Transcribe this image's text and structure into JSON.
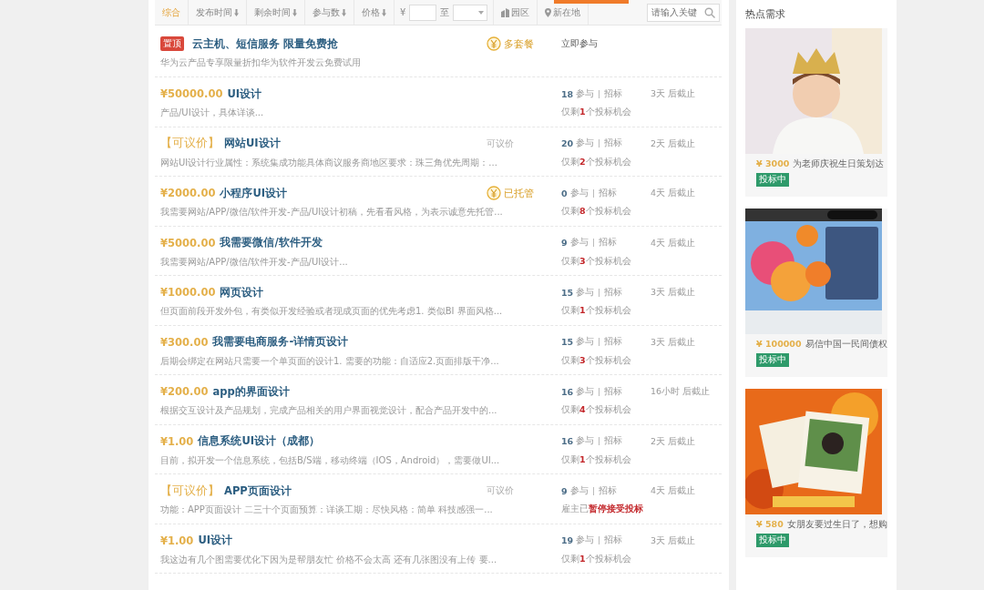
{
  "filters": {
    "sorts": [
      {
        "label": "综合",
        "arrow": false,
        "selected": true
      },
      {
        "label": "发布时间",
        "arrow": true,
        "selected": false
      },
      {
        "label": "剩余时间",
        "arrow": true,
        "selected": false
      },
      {
        "label": "参与数",
        "arrow": true,
        "selected": false
      },
      {
        "label": "价格",
        "arrow": true,
        "selected": false
      }
    ],
    "currency": "¥",
    "range_to": "至",
    "park": "园区",
    "location": "新在地",
    "search": {
      "placeholder": "请输入关键"
    }
  },
  "tasks": [
    {
      "kind": "promo",
      "tag": "置顶",
      "title": "云主机、短信服务 限量免费抢",
      "desc": "华为云产品专享限量折扣华为软件开发云免费试用",
      "mid": {
        "kind": "coin",
        "label": "多套餐"
      },
      "join": "立即参与"
    },
    {
      "kind": "task",
      "negotiable": false,
      "price": "¥50000.00",
      "title": "UI设计",
      "desc": "产品/UI设计，具体详谈...",
      "count": "18",
      "join_label": "参与",
      "mode": "招标",
      "remain": {
        "before": "仅剩",
        "num": "1",
        "after": "个投标机会"
      },
      "deadline": "3天 后截止"
    },
    {
      "kind": "task",
      "negotiable": true,
      "price": "【可议价】",
      "title": "网站UI设计",
      "desc": "网站UI设计行业属性：系统集成功能具体商议服务商地区要求：珠三角优先周期：...",
      "mid": {
        "kind": "text",
        "label": "可议价"
      },
      "count": "20",
      "join_label": "参与",
      "mode": "招标",
      "remain": {
        "before": "仅剩",
        "num": "2",
        "after": "个投标机会"
      },
      "deadline": "2天 后截止"
    },
    {
      "kind": "task",
      "negotiable": false,
      "price": "¥2000.00",
      "title": "小程序UI设计",
      "desc": "我需要网站/APP/微信/软件开发-产品/UI设计初稿，先看看风格，为表示诚意先托管...",
      "mid": {
        "kind": "coin",
        "label": "已托管"
      },
      "count": "0",
      "join_label": "参与",
      "mode": "招标",
      "remain": {
        "before": "仅剩",
        "num": "8",
        "after": "个投标机会"
      },
      "deadline": "4天 后截止"
    },
    {
      "kind": "task",
      "negotiable": false,
      "price": "¥5000.00",
      "title": "我需要微信/软件开发",
      "desc": "我需要网站/APP/微信/软件开发-产品/UI设计...",
      "count": "9",
      "join_label": "参与",
      "mode": "招标",
      "remain": {
        "before": "仅剩",
        "num": "3",
        "after": "个投标机会"
      },
      "deadline": "4天 后截止"
    },
    {
      "kind": "task",
      "negotiable": false,
      "price": "¥1000.00",
      "title": "网页设计",
      "desc": "但页面前段开发外包，有类似开发经验或者现成页面的优先考虑1. 类似BI 界面风格...",
      "count": "15",
      "join_label": "参与",
      "mode": "招标",
      "remain": {
        "before": "仅剩",
        "num": "1",
        "after": "个投标机会"
      },
      "deadline": "3天 后截止"
    },
    {
      "kind": "task",
      "negotiable": false,
      "price": "¥300.00",
      "title": "我需要电商服务-详情页设计",
      "desc": "后期会绑定在网站只需要一个单页面的设计1. 需要的功能：自适应2.页面排版干净...",
      "count": "15",
      "join_label": "参与",
      "mode": "招标",
      "remain": {
        "before": "仅剩",
        "num": "3",
        "after": "个投标机会"
      },
      "deadline": "3天 后截止"
    },
    {
      "kind": "task",
      "negotiable": false,
      "price": "¥200.00",
      "title": "app的界面设计",
      "desc": "根据交互设计及产品规划，完成产品相关的用户界面视觉设计，配合产品开发中的...",
      "count": "16",
      "join_label": "参与",
      "mode": "招标",
      "remain": {
        "before": "仅剩",
        "num": "4",
        "after": "个投标机会"
      },
      "deadline": "16小时 后截止"
    },
    {
      "kind": "task",
      "negotiable": false,
      "price": "¥1.00",
      "title": "信息系统UI设计（成都）",
      "desc": "目前，拟开发一个信息系统，包括B/S端，移动终端（IOS，Android），需要做UI...",
      "count": "16",
      "join_label": "参与",
      "mode": "招标",
      "remain": {
        "before": "仅剩",
        "num": "1",
        "after": "个投标机会"
      },
      "deadline": "2天 后截止"
    },
    {
      "kind": "task",
      "negotiable": true,
      "price": "【可议价】",
      "title": "APP页面设计",
      "desc": "功能：APP页面设计 二三十个页面预算：详谈工期：尽快风格：简单 科技感强一...",
      "mid": {
        "kind": "text",
        "label": "可议价"
      },
      "count": "9",
      "join_label": "参与",
      "mode": "招标",
      "remain": {
        "before": "雇主已",
        "num": "暂停接受投标"
      },
      "deadline": "4天 后截止"
    },
    {
      "kind": "task",
      "negotiable": false,
      "price": "¥1.00",
      "title": "UI设计",
      "desc": "我这边有几个图需要优化下因为是帮朋友忙 价格不会太高 还有几张图没有上传 要...",
      "count": "19",
      "join_label": "参与",
      "mode": "招标",
      "remain": {
        "before": "仅剩",
        "num": "1",
        "after": "个投标机会"
      },
      "deadline": "3天 后截止"
    }
  ],
  "sidebar": {
    "title": "热点需求",
    "cards": [
      {
        "kind": "child",
        "price": "¥ 3000",
        "title": "为老师庆祝生日策划达",
        "status": "投标中"
      },
      {
        "kind": "app",
        "price": "¥ 100000",
        "title": "易信中国一民间债权",
        "status": "投标中"
      },
      {
        "kind": "photos",
        "price": "¥ 580",
        "title": "女朋友要过生日了，想购",
        "status": "投标中"
      }
    ]
  }
}
